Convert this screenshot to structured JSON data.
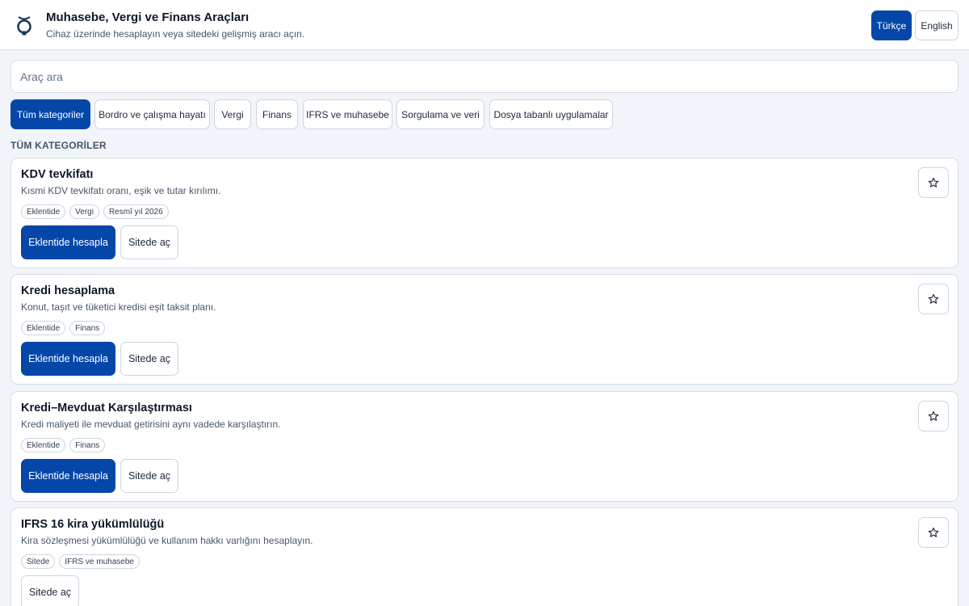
{
  "header": {
    "title": "Muhasebe, Vergi ve Finans Araçları",
    "subtitle": "Cihaz üzerinde hesaplayın veya sitedeki gelişmiş aracı açın.",
    "languages": [
      "Türkçe",
      "English"
    ]
  },
  "search": {
    "placeholder": "Araç ara"
  },
  "categories": [
    "Tüm kategoriler",
    "Bordro ve çalışma hayatı",
    "Vergi",
    "Finans",
    "IFRS ve muhasebe",
    "Sorgulama ve veri",
    "Dosya tabanlı uygulamalar"
  ],
  "section_title": "TÜM KATEGORİLER",
  "tools": [
    {
      "title": "KDV tevkifatı",
      "desc": "Kısmi KDV tevkifatı oranı, eşik ve tutar kırılımı.",
      "tags": [
        "Eklentide",
        "Vergi",
        "Resmî yıl 2026"
      ],
      "primary": "Eklentide hesapla",
      "secondary": "Sitede aç"
    },
    {
      "title": "Kredi hesaplama",
      "desc": "Konut, taşıt ve tüketici kredisi eşit taksit planı.",
      "tags": [
        "Eklentide",
        "Finans"
      ],
      "primary": "Eklentide hesapla",
      "secondary": "Sitede aç"
    },
    {
      "title": "Kredi–Mevduat Karşılaştırması",
      "desc": "Kredi maliyeti ile mevduat getirisini aynı vadede karşılaştırın.",
      "tags": [
        "Eklentide",
        "Finans"
      ],
      "primary": "Eklentide hesapla",
      "secondary": "Sitede aç"
    },
    {
      "title": "IFRS 16 kira yükümlülüğü",
      "desc": "Kira sözleşmesi yükümlülüğü ve kullanım hakkı varlığını hesaplayın.",
      "tags": [
        "Sitede",
        "IFRS ve muhasebe"
      ],
      "secondary": "Sitede aç"
    }
  ],
  "colors": {
    "accent": "#0447a8",
    "border": "#cbd5e1",
    "background": "#f1f5f9"
  },
  "icons": {
    "logo": "brand-logo-icon",
    "favorite": "star-icon"
  }
}
